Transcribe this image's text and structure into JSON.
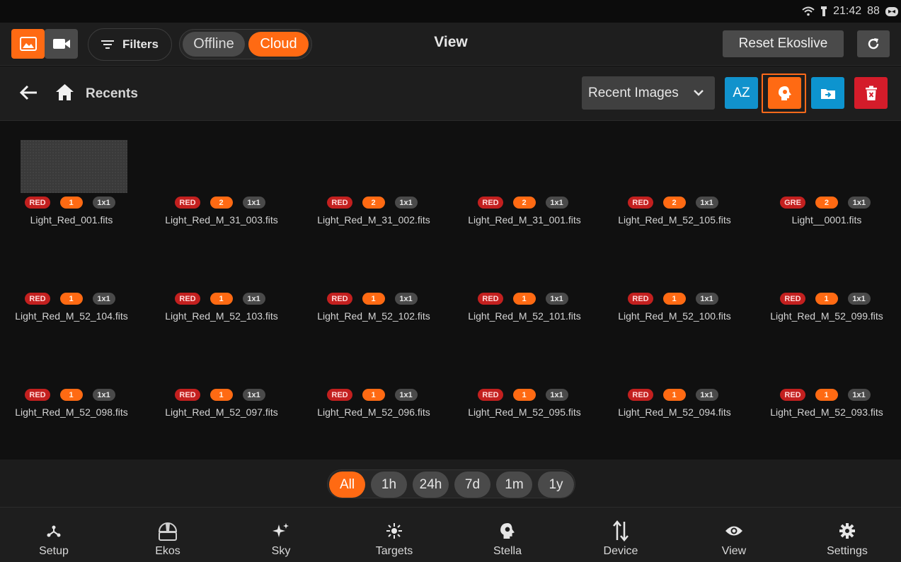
{
  "status_bar": {
    "time": "21:42",
    "battery": "88"
  },
  "top_bar": {
    "filters_label": "Filters",
    "source_options": [
      "Offline",
      "Cloud"
    ],
    "source_selected": "Cloud",
    "title": "View",
    "reset_label": "Reset Ekoslive"
  },
  "nav_bar": {
    "breadcrumb": "Recents",
    "dropdown_value": "Recent Images",
    "sort_label": "AZ"
  },
  "images": [
    {
      "name": "Light_Red_001.fits",
      "filter": "RED",
      "count": "1",
      "bin": "1x1",
      "thumbnail": true
    },
    {
      "name": "Light_Red_M_31_003.fits",
      "filter": "RED",
      "count": "2",
      "bin": "1x1"
    },
    {
      "name": "Light_Red_M_31_002.fits",
      "filter": "RED",
      "count": "2",
      "bin": "1x1"
    },
    {
      "name": "Light_Red_M_31_001.fits",
      "filter": "RED",
      "count": "2",
      "bin": "1x1"
    },
    {
      "name": "Light_Red_M_52_105.fits",
      "filter": "RED",
      "count": "2",
      "bin": "1x1"
    },
    {
      "name": "Light__0001.fits",
      "filter": "GRE",
      "count": "2",
      "bin": "1x1"
    },
    {
      "name": "Light_Red_M_52_104.fits",
      "filter": "RED",
      "count": "1",
      "bin": "1x1"
    },
    {
      "name": "Light_Red_M_52_103.fits",
      "filter": "RED",
      "count": "1",
      "bin": "1x1"
    },
    {
      "name": "Light_Red_M_52_102.fits",
      "filter": "RED",
      "count": "1",
      "bin": "1x1"
    },
    {
      "name": "Light_Red_M_52_101.fits",
      "filter": "RED",
      "count": "1",
      "bin": "1x1"
    },
    {
      "name": "Light_Red_M_52_100.fits",
      "filter": "RED",
      "count": "1",
      "bin": "1x1"
    },
    {
      "name": "Light_Red_M_52_099.fits",
      "filter": "RED",
      "count": "1",
      "bin": "1x1"
    },
    {
      "name": "Light_Red_M_52_098.fits",
      "filter": "RED",
      "count": "1",
      "bin": "1x1"
    },
    {
      "name": "Light_Red_M_52_097.fits",
      "filter": "RED",
      "count": "1",
      "bin": "1x1"
    },
    {
      "name": "Light_Red_M_52_096.fits",
      "filter": "RED",
      "count": "1",
      "bin": "1x1"
    },
    {
      "name": "Light_Red_M_52_095.fits",
      "filter": "RED",
      "count": "1",
      "bin": "1x1"
    },
    {
      "name": "Light_Red_M_52_094.fits",
      "filter": "RED",
      "count": "1",
      "bin": "1x1"
    },
    {
      "name": "Light_Red_M_52_093.fits",
      "filter": "RED",
      "count": "1",
      "bin": "1x1"
    }
  ],
  "time_filters": [
    "All",
    "1h",
    "24h",
    "7d",
    "1m",
    "1y"
  ],
  "time_filter_selected": "All",
  "bottom_nav": [
    {
      "label": "Setup",
      "icon": "setup-icon"
    },
    {
      "label": "Ekos",
      "icon": "observatory-icon"
    },
    {
      "label": "Sky",
      "icon": "sparkles-icon"
    },
    {
      "label": "Targets",
      "icon": "target-icon"
    },
    {
      "label": "Stella",
      "icon": "stella-head-icon"
    },
    {
      "label": "Device",
      "icon": "transfer-arrows-icon"
    },
    {
      "label": "View",
      "icon": "eye-icon"
    },
    {
      "label": "Settings",
      "icon": "gear-icon"
    }
  ],
  "colors": {
    "accent": "#ff6a13",
    "sort_button": "#1192cc",
    "folder_button": "#0d94cf",
    "delete_button": "#d41c2a",
    "filter_badge": "#c3201f"
  }
}
